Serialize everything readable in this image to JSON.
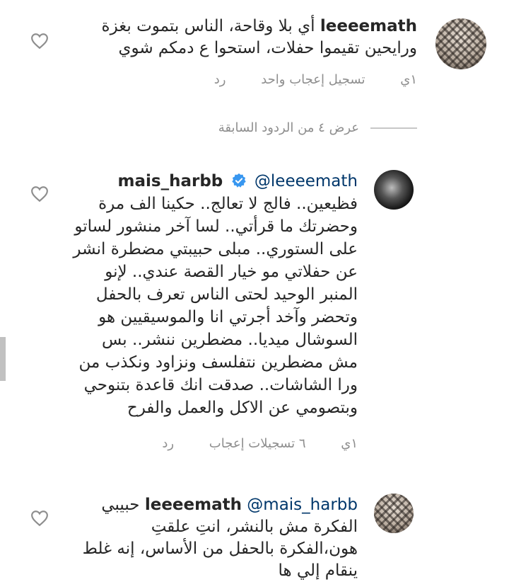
{
  "comments": [
    {
      "username": "leeeemath",
      "text": "أي بلا وقاحة، الناس بتموت بغزة ورايحين تقيموا حفلات، استحوا ع دمكم شوي",
      "time": "١ي",
      "likes": "تسجيل إعجاب واحد",
      "reply": "رد",
      "avatar": "keffiyeh"
    },
    {
      "username": "mais_harbb",
      "verified": true,
      "mention": "@leeeemath",
      "text": "فظيعين.. فالج لا تعالج.. حكينا الف مرة وحضرتك ما قرأتي.. لسا آخر منشور لساتو على الستوري.. مبلى حبيبتي مضطرة انشر عن حفلاتي مو خيار القصة عندي.. لإنو المنبر الوحيد لحتى الناس تعرف بالحفل وتحضر وآخد أجرتي انا والموسيقيين هو السوشال ميديا.. مضطرين ننشر.. بس مش مضطرين نتفلسف ونزاود ونكذب من ورا الشاشات.. صدقت انك قاعدة بتنوحي وبتصومي عن الاكل والعمل والفرح",
      "time": "١ي",
      "likes": "٦ تسجيلات إعجاب",
      "reply": "رد",
      "avatar": "dark"
    },
    {
      "username": "leeeemath",
      "mention": "@mais_harbb",
      "text": "حبيبي الفكرة مش بالنشر، انتِ علقتِ هون،الفكرة بالحفل من الأساس، إنه غلط ينقام إلي ها",
      "avatar": "keffiyeh"
    }
  ],
  "view_replies": "عرض ٤ من الردود السابقة",
  "icons": {
    "like": "heart-icon",
    "verified": "verified-badge-icon"
  },
  "colors": {
    "mention": "#00376b",
    "muted": "#8e8e8e",
    "verified": "#3897f0"
  }
}
